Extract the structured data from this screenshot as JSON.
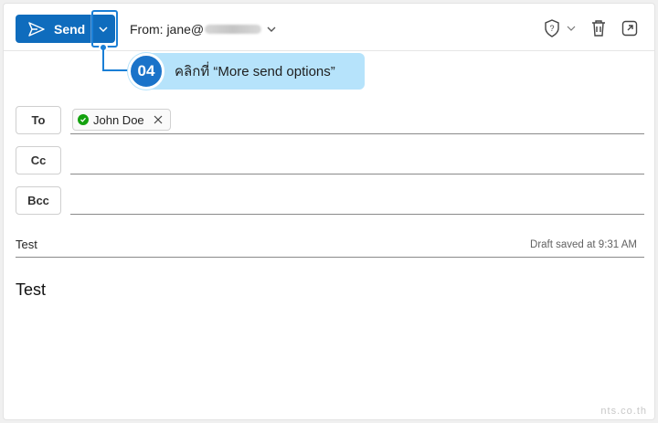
{
  "toolbar": {
    "send_label": "Send",
    "from_label": "From: jane@",
    "icons": [
      "sensitivity-icon",
      "delete-icon",
      "pop-out-icon"
    ]
  },
  "callout": {
    "step": "04",
    "text": "คลิกที่ “More send options”"
  },
  "recipients": {
    "to_label": "To",
    "cc_label": "Cc",
    "bcc_label": "Bcc",
    "to_chip": "John Doe"
  },
  "subject": {
    "value": "Test",
    "draft_status": "Draft saved at 9:31 AM"
  },
  "body": {
    "text": "Test"
  },
  "watermark": "nts.co.th",
  "colors": {
    "accent": "#0f6cbd",
    "callout_bg": "#b6e3fb",
    "callout_accent": "#1a73c9",
    "chip_ok": "#13a10e"
  }
}
